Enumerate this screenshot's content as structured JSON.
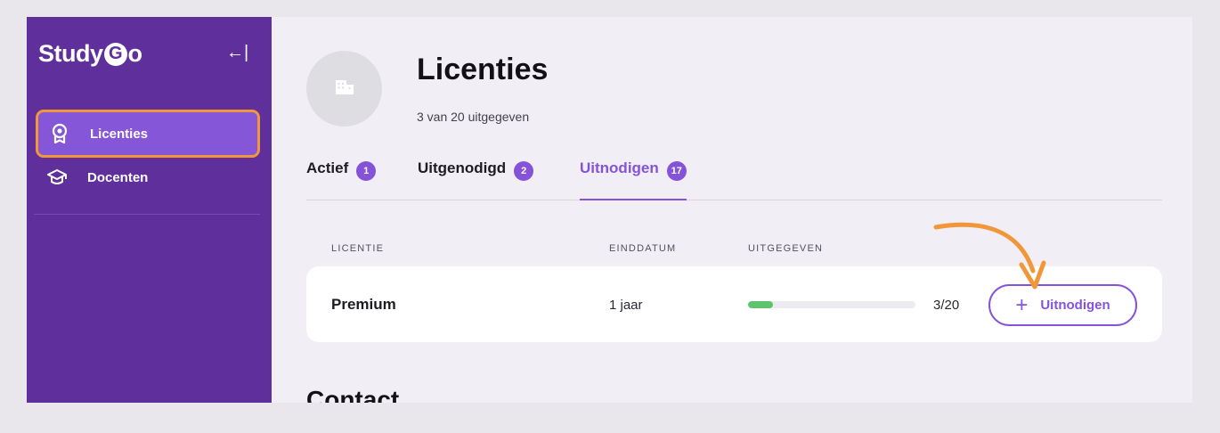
{
  "sidebar": {
    "logo_prefix": "Study",
    "logo_g": "G",
    "logo_suffix": "o",
    "collapse_icon": "←|",
    "items": [
      {
        "label": "Licenties",
        "icon": "award-icon",
        "active": true
      },
      {
        "label": "Docenten",
        "icon": "graduation-cap-icon",
        "active": false
      }
    ]
  },
  "header": {
    "title": "Licenties",
    "subtitle": "3 van 20 uitgegeven",
    "avatar_icon": "building-icon"
  },
  "tabs": [
    {
      "label": "Actief",
      "count": "1"
    },
    {
      "label": "Uitgenodigd",
      "count": "2"
    },
    {
      "label": "Uitnodigen",
      "count": "17",
      "active": true
    }
  ],
  "table": {
    "headers": [
      "LICENTIE",
      "EINDDATUM",
      "UITGEGEVEN"
    ],
    "rows": [
      {
        "license": "Premium",
        "end_date": "1 jaar",
        "issued": "3/20",
        "issued_fraction": 0.15,
        "action": "Uitnodigen"
      }
    ]
  },
  "section_heading": "Contact",
  "colors": {
    "sidebar": "#5f2f9c",
    "accent": "#8553d8",
    "highlight": "#f1973a",
    "progress": "#5ec36c"
  }
}
